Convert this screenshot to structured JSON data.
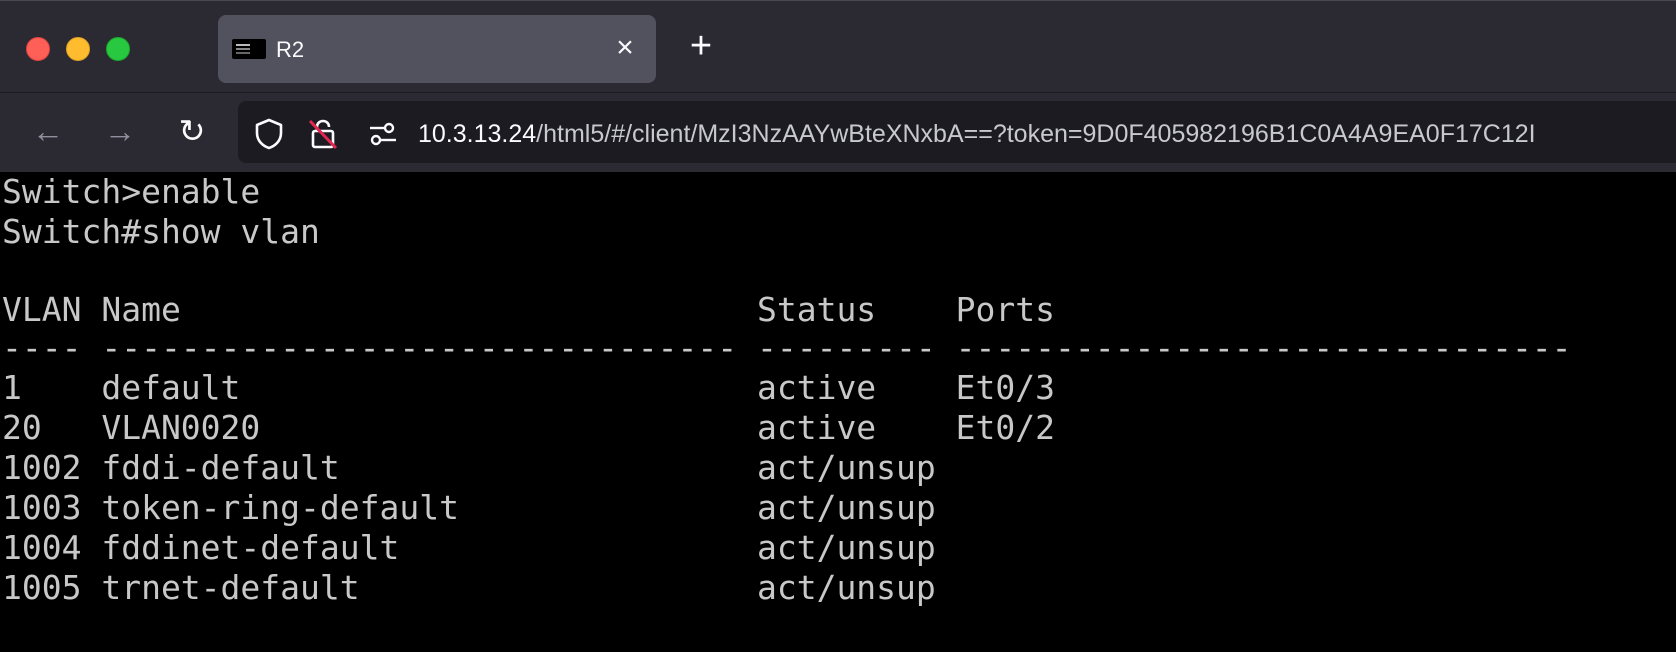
{
  "window": {
    "traffic_lights": [
      "close",
      "minimize",
      "zoom"
    ]
  },
  "tab": {
    "title": "R2",
    "close_glyph": "×",
    "favicon": "terminal-icon"
  },
  "new_tab_glyph": "+",
  "nav": {
    "back_glyph": "←",
    "forward_glyph": "→",
    "reload_glyph": "↻"
  },
  "url": {
    "host": "10.3.13.24",
    "path": "/html5/#/client/MzI3NzAAYwBteXNxbA==?token=9D0F405982196B1C0A4A9EA0F17C12I"
  },
  "terminal": {
    "lines": [
      "Switch>enable",
      "Switch#show vlan",
      "",
      "VLAN Name                             Status    Ports",
      "---- -------------------------------- --------- -------------------------------",
      "1    default                          active    Et0/3",
      "20   VLAN0020                         active    Et0/2",
      "1002 fddi-default                     act/unsup",
      "1003 token-ring-default               act/unsup",
      "1004 fddinet-default                  act/unsup",
      "1005 trnet-default                    act/unsup"
    ]
  }
}
